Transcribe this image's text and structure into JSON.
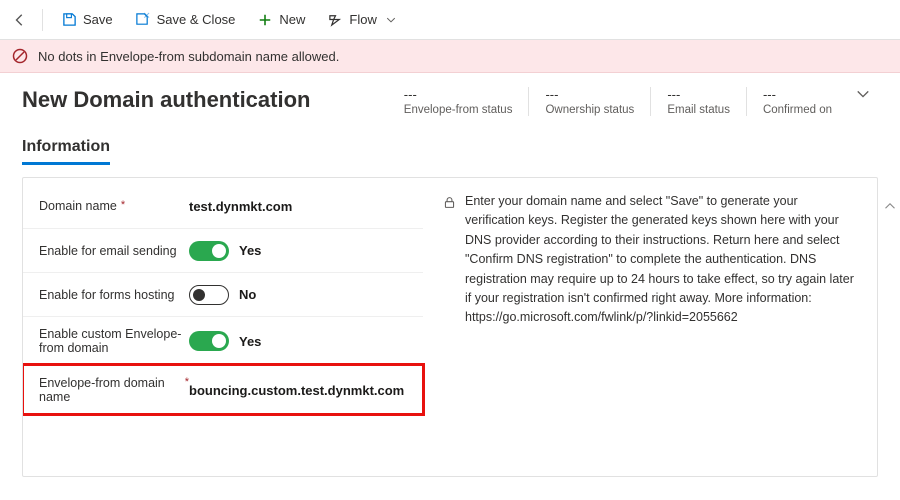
{
  "toolbar": {
    "save": "Save",
    "save_close": "Save & Close",
    "new": "New",
    "flow": "Flow"
  },
  "error": {
    "message": "No dots in Envelope-from subdomain name allowed."
  },
  "header": {
    "title": "New Domain authentication",
    "statuses": [
      {
        "value": "---",
        "label": "Envelope-from status"
      },
      {
        "value": "---",
        "label": "Ownership status"
      },
      {
        "value": "---",
        "label": "Email status"
      },
      {
        "value": "---",
        "label": "Confirmed on"
      }
    ]
  },
  "section": {
    "title": "Information"
  },
  "form": {
    "domain_name_label": "Domain name",
    "domain_name_value": "test.dynmkt.com",
    "enable_email_label": "Enable for email sending",
    "enable_email_value": "Yes",
    "enable_forms_label": "Enable for forms hosting",
    "enable_forms_value": "No",
    "enable_custom_env_label": "Enable custom Envelope-from domain",
    "enable_custom_env_value": "Yes",
    "env_domain_label": "Envelope-from domain name",
    "env_domain_value": "bouncing.custom.test.dynmkt.com"
  },
  "info": {
    "text": "Enter your domain name and select \"Save\" to generate your verification keys. Register the generated keys shown here with your DNS provider according to their instructions. Return here and select \"Confirm DNS registration\" to complete the authentication. DNS registration may require up to 24 hours to take effect, so try again later if your registration isn't confirmed right away. More information:",
    "link": "https://go.microsoft.com/fwlink/p/?linkid=2055662"
  }
}
